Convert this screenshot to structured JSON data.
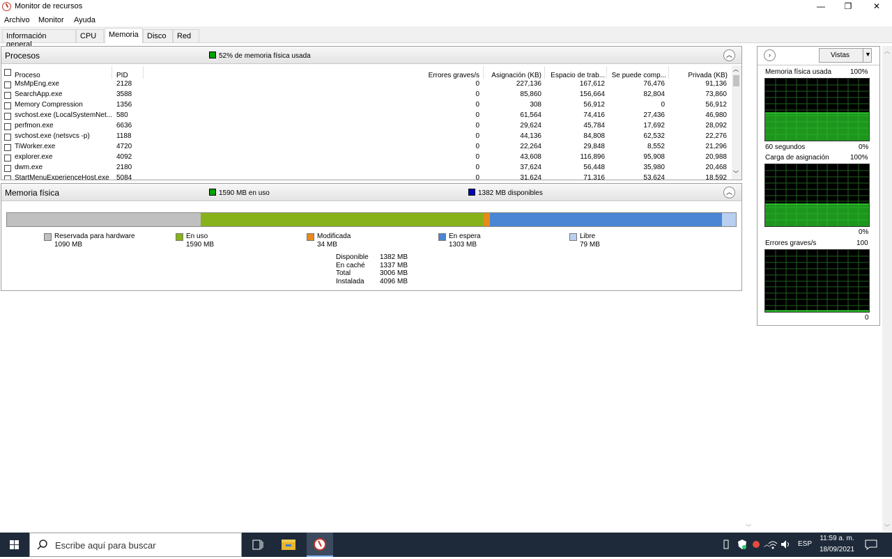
{
  "window": {
    "title": "Monitor de recursos",
    "controls": {
      "minimize": "—",
      "maximize": "❐",
      "close": "✕"
    }
  },
  "menu": [
    "Archivo",
    "Monitor",
    "Ayuda"
  ],
  "tabs": [
    "Información general",
    "CPU",
    "Memoria",
    "Disco",
    "Red"
  ],
  "active_tab": "Memoria",
  "processes": {
    "title": "Procesos",
    "usage_note": "52% de memoria física usada",
    "usage_color": "#00a000",
    "columns": [
      "Proceso",
      "PID",
      "Errores graves/s",
      "Asignación (KB)",
      "Espacio de trab...",
      "Se puede comp...",
      "Privada (KB)"
    ],
    "rows": [
      [
        "MsMpEng.exe",
        "2128",
        "0",
        "227,136",
        "167,612",
        "76,476",
        "91,136"
      ],
      [
        "SearchApp.exe",
        "3588",
        "0",
        "85,860",
        "156,664",
        "82,804",
        "73,860"
      ],
      [
        "Memory Compression",
        "1356",
        "0",
        "308",
        "56,912",
        "0",
        "56,912"
      ],
      [
        "svchost.exe (LocalSystemNet...",
        "580",
        "0",
        "61,564",
        "74,416",
        "27,436",
        "46,980"
      ],
      [
        "perfmon.exe",
        "6636",
        "0",
        "29,624",
        "45,784",
        "17,692",
        "28,092"
      ],
      [
        "svchost.exe (netsvcs -p)",
        "1188",
        "0",
        "44,136",
        "84,808",
        "62,532",
        "22,276"
      ],
      [
        "TiWorker.exe",
        "4720",
        "0",
        "22,264",
        "29,848",
        "8,552",
        "21,296"
      ],
      [
        "explorer.exe",
        "4092",
        "0",
        "43,608",
        "116,896",
        "95,908",
        "20,988"
      ],
      [
        "dwm.exe",
        "2180",
        "0",
        "37,624",
        "56,448",
        "35,980",
        "20,468"
      ],
      [
        "StartMenuExperienceHost.exe",
        "5084",
        "0",
        "31,624",
        "71,316",
        "53,624",
        "18,592"
      ]
    ]
  },
  "physical_memory": {
    "title": "Memoria física",
    "in_use_note": "1590 MB en uso",
    "available_note": "1382 MB disponibles",
    "in_use_color": "#00a000",
    "available_color": "#0000c0",
    "segments": [
      {
        "label": "Reservada para hardware",
        "value": "1090 MB",
        "mb": 1090,
        "color": "#c0c0c0"
      },
      {
        "label": "En uso",
        "value": "1590 MB",
        "mb": 1590,
        "color": "#88b21a"
      },
      {
        "label": "Modificada",
        "value": "34 MB",
        "mb": 34,
        "color": "#e78a1c"
      },
      {
        "label": "En espera",
        "value": "1303 MB",
        "mb": 1303,
        "color": "#4a86d4"
      },
      {
        "label": "Libre",
        "value": "79 MB",
        "mb": 79,
        "color": "#b8cff0"
      }
    ],
    "summary": [
      {
        "label": "Disponible",
        "value": "1382 MB"
      },
      {
        "label": "En caché",
        "value": "1337 MB"
      },
      {
        "label": "Total",
        "value": "3006 MB"
      },
      {
        "label": "Instalada",
        "value": "4096 MB"
      }
    ]
  },
  "views": {
    "button": "Vistas",
    "graphs": [
      {
        "title": "Memoria física usada",
        "max": "100%",
        "bottom_left": "60 segundos",
        "bottom_right": "0%",
        "level": 0.45
      },
      {
        "title": "Carga de asignación",
        "max": "100%",
        "bottom_left": "",
        "bottom_right": "0%",
        "level": 0.36
      },
      {
        "title": "Errores graves/s",
        "max": "100",
        "bottom_left": "",
        "bottom_right": "0",
        "level": 0.02
      }
    ]
  },
  "taskbar": {
    "search_placeholder": "Escribe aquí para buscar",
    "language": "ESP",
    "time": "11:59 a. m.",
    "date": "18/09/2021"
  }
}
